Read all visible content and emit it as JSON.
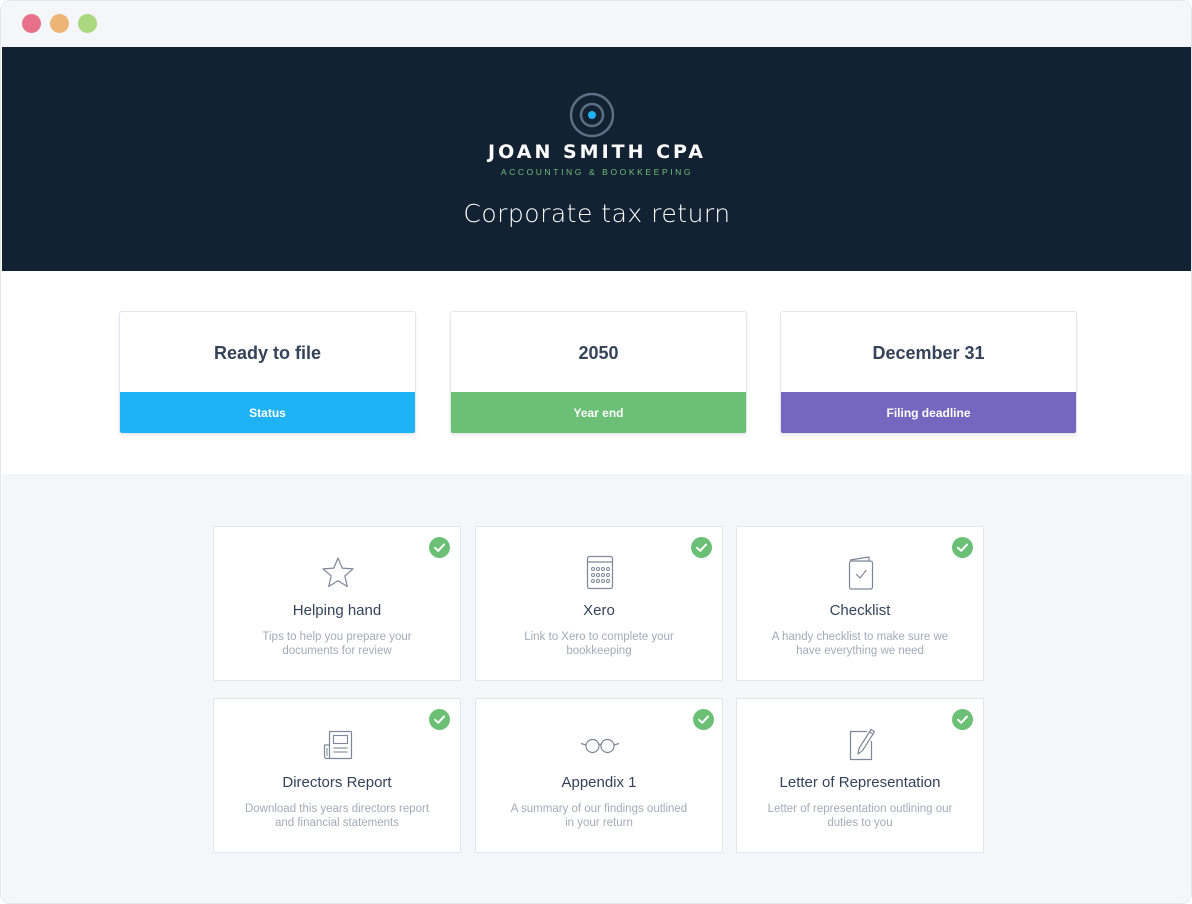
{
  "window": {
    "controls": [
      "close",
      "minimize",
      "zoom"
    ]
  },
  "hero": {
    "brand": "JOAN SMITH CPA",
    "tagline": "ACCOUNTING & BOOKKEEPING",
    "title": "Corporate tax return",
    "background": "#132232",
    "accent": "#6cc07a"
  },
  "stats": [
    {
      "value": "Ready to file",
      "label": "Status",
      "color": "#1fb3f5"
    },
    {
      "value": "2050",
      "label": "Year end",
      "color": "#6cc076"
    },
    {
      "value": "December 31",
      "label": "Filing deadline",
      "color": "#7567bf"
    }
  ],
  "documents": [
    {
      "title": "Helping hand",
      "description": "Tips to help you prepare your documents for review",
      "icon": "star-icon",
      "complete": true
    },
    {
      "title": "Xero",
      "description": "Link to Xero to complete your bookkeeping",
      "icon": "calculator-icon",
      "complete": true
    },
    {
      "title": "Checklist",
      "description": "A handy checklist to make sure we have everything we need",
      "icon": "checklist-icon",
      "complete": true
    },
    {
      "title": "Directors Report",
      "description": "Download this years directors report and financial statements",
      "icon": "newspaper-icon",
      "complete": true
    },
    {
      "title": "Appendix 1",
      "description": "A summary of our findings outlined in your return",
      "icon": "glasses-icon",
      "complete": true
    },
    {
      "title": "Letter of Representation",
      "description": "Letter of representation outlining our duties to you",
      "icon": "edit-document-icon",
      "complete": true
    }
  ]
}
